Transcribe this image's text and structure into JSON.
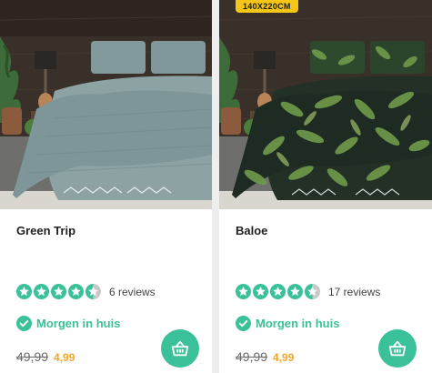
{
  "colors": {
    "accent": "#3bc199",
    "sale": "#f5a623",
    "badge": "#f5c518"
  },
  "products": [
    {
      "name": "Green Trip",
      "rating": 4.5,
      "max_rating": 5,
      "reviews": "6 reviews",
      "delivery": "Morgen in huis",
      "old_price": "49,99",
      "new_price": "4,99",
      "image_icon": "bedding-photo",
      "cart_icon": "basket-icon"
    },
    {
      "name": "Baloe",
      "badge": "140X220CM",
      "rating": 4.5,
      "max_rating": 5,
      "reviews": "17 reviews",
      "delivery": "Morgen in huis",
      "old_price": "49,99",
      "new_price": "4,99",
      "image_icon": "bedding-photo",
      "cart_icon": "basket-icon"
    }
  ]
}
